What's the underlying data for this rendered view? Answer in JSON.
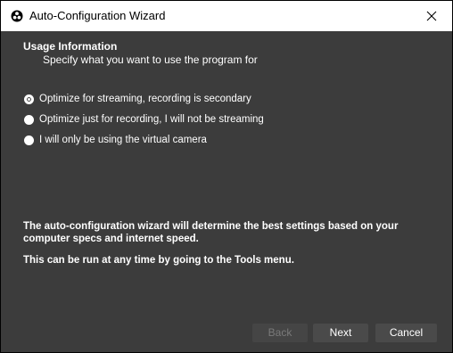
{
  "window": {
    "title": "Auto-Configuration Wizard",
    "icon": "obs-logo-icon",
    "close_icon": "close-icon"
  },
  "section": {
    "title": "Usage Information",
    "subtitle": "Specify what you want to use the program for"
  },
  "options": [
    {
      "label": "Optimize for streaming, recording is secondary",
      "selected": true
    },
    {
      "label": "Optimize just for recording, I will not be streaming",
      "selected": false
    },
    {
      "label": "I will only be using the virtual camera",
      "selected": false
    }
  ],
  "info": {
    "line1": "The auto-configuration wizard will determine the best settings based on your computer specs and internet speed.",
    "line2": "This can be run at any time by going to the Tools menu."
  },
  "buttons": {
    "back": "Back",
    "back_enabled": false,
    "next": "Next",
    "cancel": "Cancel"
  },
  "colors": {
    "background": "#3c3c3c",
    "titlebar": "#ffffff",
    "button": "#4a4a4a",
    "text": "#ffffff"
  }
}
